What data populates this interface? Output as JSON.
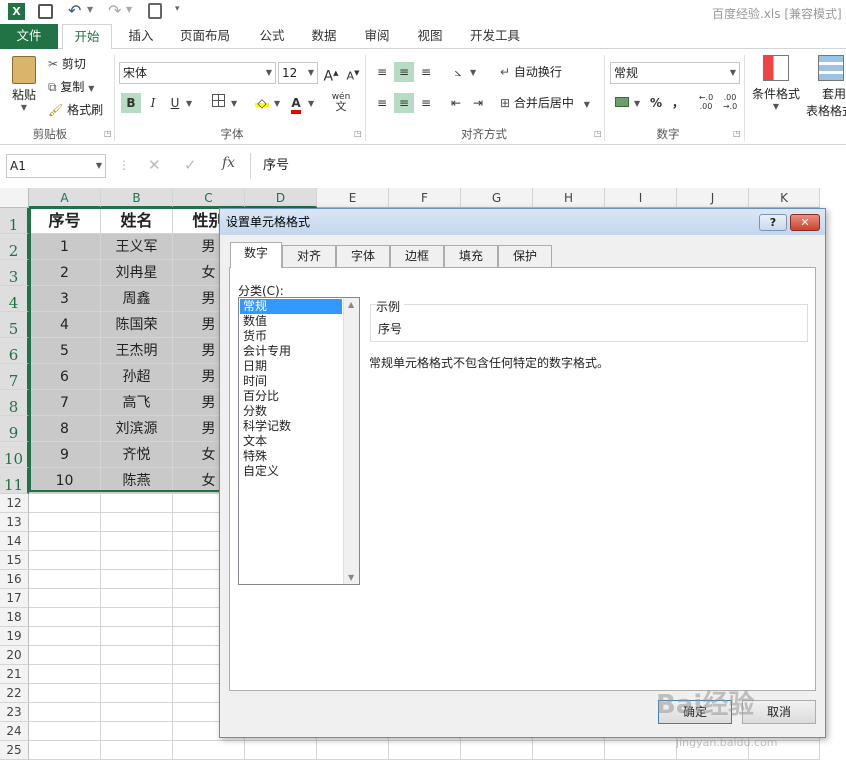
{
  "titlebar": {
    "filename": "百度经验.xls",
    "mode": "[兼容模式]"
  },
  "ribbon_tabs": [
    {
      "label": "文件"
    },
    {
      "label": "开始"
    },
    {
      "label": "插入"
    },
    {
      "label": "页面布局"
    },
    {
      "label": "公式"
    },
    {
      "label": "数据"
    },
    {
      "label": "审阅"
    },
    {
      "label": "视图"
    },
    {
      "label": "开发工具"
    }
  ],
  "clipboard": {
    "paste": "粘贴",
    "cut": "剪切",
    "copy": "复制",
    "painter": "格式刷",
    "group": "剪贴板"
  },
  "font": {
    "name": "宋体",
    "size": "12",
    "bold": "B",
    "italic": "I",
    "underline": "U",
    "group": "字体",
    "grow": "A",
    "shrink": "A",
    "wen": "wén"
  },
  "alignment": {
    "wrap": "自动换行",
    "merge": "合并后居中",
    "group": "对齐方式"
  },
  "number": {
    "format": "常规",
    "percent": "%",
    "comma": "，",
    "group": "数字"
  },
  "styles": {
    "cond": "条件格式",
    "table": "套用",
    "table2": "表格格式"
  },
  "formula": {
    "namebox": "A1",
    "content": "序号"
  },
  "colors": {
    "accent": "#217346",
    "selection": "#c9c9c9"
  },
  "columns": [
    "A",
    "B",
    "C",
    "D",
    "E",
    "F",
    "G",
    "H",
    "I",
    "J",
    "K"
  ],
  "rows": [
    "1",
    "2",
    "3",
    "4",
    "5",
    "6",
    "7",
    "8",
    "9",
    "10",
    "11",
    "12",
    "13",
    "14",
    "15",
    "16",
    "17",
    "18",
    "19",
    "20",
    "21",
    "22",
    "23",
    "24",
    "25"
  ],
  "table": {
    "headers": [
      "序号",
      "姓名",
      "性别"
    ],
    "records": [
      [
        "1",
        "王义军",
        "男"
      ],
      [
        "2",
        "刘冉星",
        "女"
      ],
      [
        "3",
        "周鑫",
        "男"
      ],
      [
        "4",
        "陈国荣",
        "男"
      ],
      [
        "5",
        "王杰明",
        "男"
      ],
      [
        "6",
        "孙超",
        "男"
      ],
      [
        "7",
        "高飞",
        "男"
      ],
      [
        "8",
        "刘滨源",
        "男"
      ],
      [
        "9",
        "齐悦",
        "女"
      ],
      [
        "10",
        "陈燕",
        "女"
      ]
    ]
  },
  "dialog": {
    "title": "设置单元格格式",
    "help": "?",
    "close": "✕",
    "tabs": [
      "数字",
      "对齐",
      "字体",
      "边框",
      "填充",
      "保护"
    ],
    "category_label": "分类(C):",
    "categories": [
      "常规",
      "数值",
      "货币",
      "会计专用",
      "日期",
      "时间",
      "百分比",
      "分数",
      "科学记数",
      "文本",
      "特殊",
      "自定义"
    ],
    "sample_label": "示例",
    "sample_value": "序号",
    "description": "常规单元格格式不包含任何特定的数字格式。",
    "ok": "确定",
    "cancel": "取消"
  },
  "watermark": {
    "text": "Bai经验",
    "sub": "jingyan.baidu.com"
  }
}
